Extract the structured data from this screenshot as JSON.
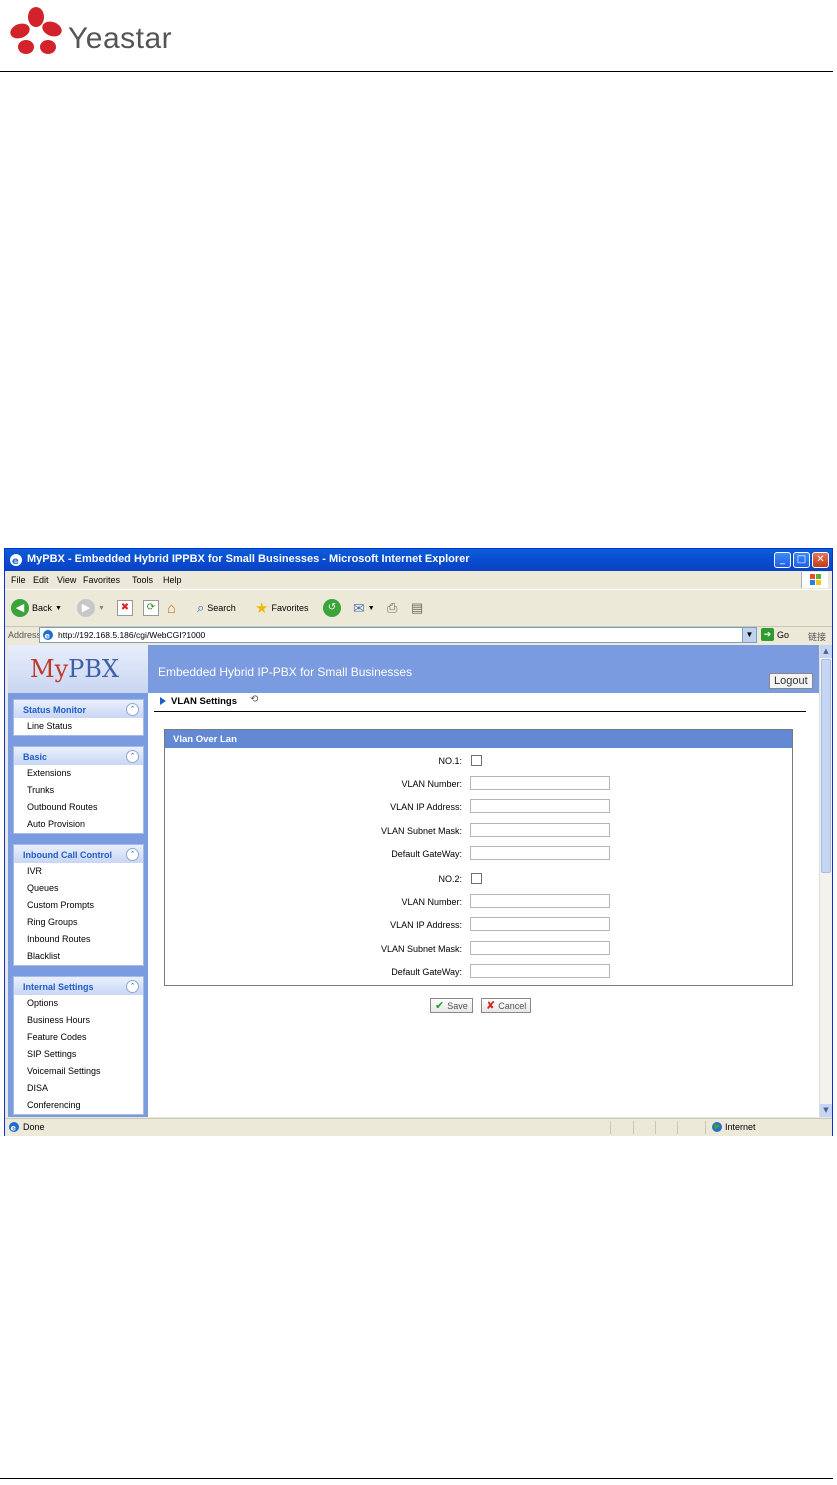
{
  "doc": {
    "brand": "Yeastar"
  },
  "browser": {
    "title": "MyPBX - Embedded Hybrid IPPBX for Small Businesses - Microsoft Internet Explorer",
    "menu": [
      "File",
      "Edit",
      "View",
      "Favorites",
      "Tools",
      "Help"
    ],
    "toolbar": {
      "back": "Back",
      "search": "Search",
      "favorites": "Favorites"
    },
    "address_label": "Address",
    "url": "http://192.168.5.186/cgi/WebCGI?1000",
    "go": "Go",
    "links": "链接",
    "status_text": "Done",
    "status_zone": "Internet"
  },
  "app": {
    "logo_my": "My",
    "logo_pbx": "PBX",
    "title": "Embedded Hybrid IP-PBX for Small Businesses",
    "logout": "Logout"
  },
  "sidebar": {
    "groups": [
      {
        "title": "Status Monitor",
        "items": [
          "Line Status"
        ]
      },
      {
        "title": "Basic",
        "items": [
          "Extensions",
          "Trunks",
          "Outbound Routes",
          "Auto Provision"
        ]
      },
      {
        "title": "Inbound Call Control",
        "items": [
          "IVR",
          "Queues",
          "Custom Prompts",
          "Ring Groups",
          "Inbound Routes",
          "Blacklist"
        ]
      },
      {
        "title": "Internal Settings",
        "items": [
          "Options",
          "Business Hours",
          "Feature Codes",
          "SIP Settings",
          "Voicemail Settings",
          "DISA",
          "Conferencing"
        ]
      }
    ]
  },
  "page": {
    "breadcrumb": "VLAN Settings",
    "panel_title": "Vlan Over Lan",
    "rows": [
      {
        "label": "NO.1:",
        "type": "checkbox"
      },
      {
        "label": "VLAN Number:",
        "type": "text"
      },
      {
        "label": "VLAN IP Address:",
        "type": "text"
      },
      {
        "label": "VLAN Subnet Mask:",
        "type": "text"
      },
      {
        "label": "Default GateWay:",
        "type": "text"
      },
      {
        "label": "NO.2:",
        "type": "checkbox"
      },
      {
        "label": "VLAN Number:",
        "type": "text"
      },
      {
        "label": "VLAN IP Address:",
        "type": "text"
      },
      {
        "label": "VLAN Subnet Mask:",
        "type": "text"
      },
      {
        "label": "Default GateWay:",
        "type": "text"
      }
    ],
    "save": "Save",
    "cancel": "Cancel"
  },
  "colors": {
    "accent": "#7b9be0",
    "panel_header": "#6389d5",
    "link_blue": "#215dc6"
  }
}
